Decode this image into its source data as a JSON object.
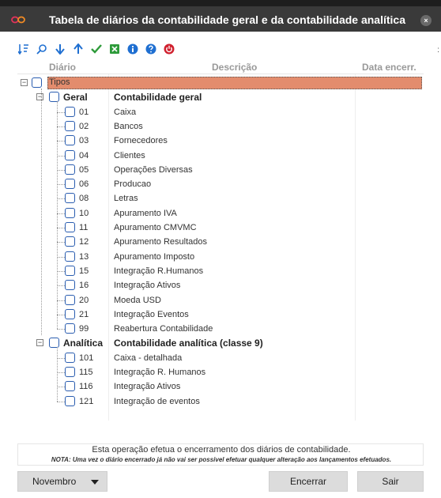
{
  "window": {
    "title": "Tabela de diários da contabilidade geral e da contabilidade analítica",
    "close_label": "×"
  },
  "toolbar": {
    "icons": [
      "sort-icon",
      "search-icon",
      "arrow-down-icon",
      "arrow-up-icon",
      "check-icon",
      "excel-icon",
      "info-icon",
      "help-icon",
      "power-icon"
    ],
    "colors": {
      "blue": "#1f6fd1",
      "green": "#2e9b3a",
      "red": "#d0202e"
    }
  },
  "grid": {
    "headers": {
      "diario": "Diário",
      "descricao": "Descrição",
      "data": "Data encerr."
    },
    "root": {
      "label": "Tipos",
      "highlight_color": "#e38c6d"
    },
    "groups": [
      {
        "code": "Geral",
        "description": "Contabilidade geral",
        "items": [
          {
            "code": "01",
            "description": "Caixa"
          },
          {
            "code": "02",
            "description": "Bancos"
          },
          {
            "code": "03",
            "description": "Fornecedores"
          },
          {
            "code": "04",
            "description": "Clientes"
          },
          {
            "code": "05",
            "description": "Operações Diversas"
          },
          {
            "code": "06",
            "description": "Producao"
          },
          {
            "code": "08",
            "description": "Letras"
          },
          {
            "code": "10",
            "description": "Apuramento IVA"
          },
          {
            "code": "11",
            "description": "Apuramento CMVMC"
          },
          {
            "code": "12",
            "description": "Apuramento Resultados"
          },
          {
            "code": "13",
            "description": "Apuramento Imposto"
          },
          {
            "code": "15",
            "description": "Integração R.Humanos"
          },
          {
            "code": "16",
            "description": "Integração Ativos"
          },
          {
            "code": "20",
            "description": "Moeda USD"
          },
          {
            "code": "21",
            "description": "Integração Eventos"
          },
          {
            "code": "99",
            "description": "Reabertura Contabilidade"
          }
        ]
      },
      {
        "code": "Analítica",
        "description": "Contabilidade analítica (classe 9)",
        "items": [
          {
            "code": "101",
            "description": "Caixa - detalhada"
          },
          {
            "code": "115",
            "description": "Integração R. Humanos"
          },
          {
            "code": "116",
            "description": "Integração Ativos"
          },
          {
            "code": "121",
            "description": "Integração de eventos"
          }
        ]
      }
    ]
  },
  "footer": {
    "message": "Esta operação efetua o encerramento dos diários de contabilidade.",
    "note": "NOTA: Uma vez o diário encerrado já não vai ser possivel efetuar qualquer alteração aos lançamentos efetuados."
  },
  "buttons": {
    "month": "Novembro",
    "encerrar": "Encerrar",
    "sair": "Sair"
  }
}
